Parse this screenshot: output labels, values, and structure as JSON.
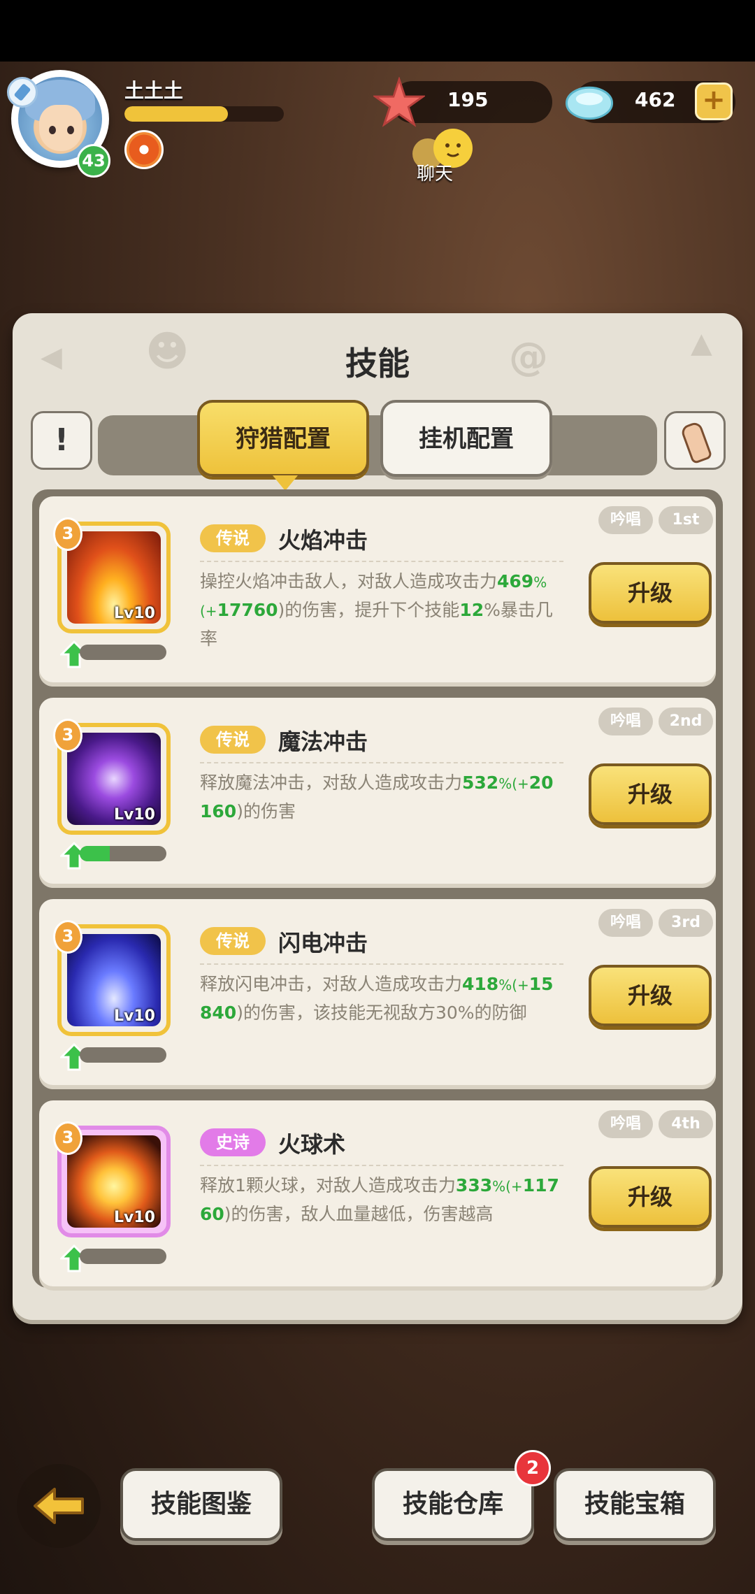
{
  "player": {
    "name": "土土土",
    "level": "43",
    "xp_fraction": 0.65
  },
  "resources": {
    "starfish": "195",
    "gems": "462",
    "add": "+"
  },
  "chat": {
    "label": "聊天"
  },
  "panel": {
    "title": "技能",
    "info": "!"
  },
  "tabs": {
    "hunt": "狩猎配置",
    "idle": "挂机配置",
    "active": "hunt"
  },
  "skills": [
    {
      "rank": "3",
      "level": "Lv10",
      "rarity": "传说",
      "name": "火焰冲击",
      "tag_chant": "吟唱",
      "tag_order": "1st",
      "upgrade": "升级",
      "progress": 0.0,
      "desc": [
        "操控火焰冲击敌人，对敌人造成攻击力",
        "469",
        "%(+",
        "17760",
        ")的伤害，提升下个技能",
        "12",
        "%暴击几率"
      ]
    },
    {
      "rank": "3",
      "level": "Lv10",
      "rarity": "传说",
      "name": "魔法冲击",
      "tag_chant": "吟唱",
      "tag_order": "2nd",
      "upgrade": "升级",
      "progress": 0.35,
      "desc": [
        "释放魔法冲击，对敌人造成攻击力",
        "532",
        "%(+",
        "20160",
        ")的伤害"
      ]
    },
    {
      "rank": "3",
      "level": "Lv10",
      "rarity": "传说",
      "name": "闪电冲击",
      "tag_chant": "吟唱",
      "tag_order": "3rd",
      "upgrade": "升级",
      "progress": 0.0,
      "desc": [
        "释放闪电冲击，对敌人造成攻击力",
        "418",
        "%(+",
        "15840",
        ")的伤害，该技能无视敌方30%的防御"
      ]
    },
    {
      "rank": "3",
      "level": "Lv10",
      "rarity": "史诗",
      "name": "火球术",
      "tag_chant": "吟唱",
      "tag_order": "4th",
      "upgrade": "升级",
      "progress": 0.0,
      "desc": [
        "释放1颗火球，对敌人造成攻击力",
        "333",
        "%(+",
        "11760",
        ")的伤害，敌人血量越低，伤害越高"
      ]
    }
  ],
  "bottom": {
    "codex": "技能图鉴",
    "storage": "技能仓库",
    "chest": "技能宝箱",
    "storage_badge": "2"
  },
  "colors": {
    "accent_yellow": "#f0c23a",
    "epic_pink": "#e27be8",
    "green": "#2ca83a"
  }
}
